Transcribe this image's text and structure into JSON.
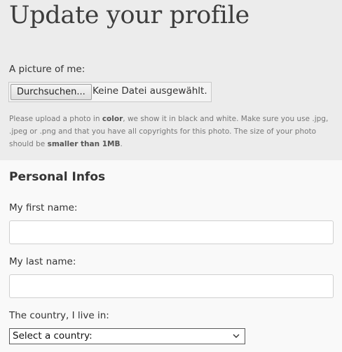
{
  "header": {
    "title": "Update your profile"
  },
  "picture": {
    "label": "A picture of me:",
    "button_label": "Durchsuchen...",
    "file_status": "Keine Datei ausgewählt.",
    "help": {
      "part1": "Please upload a photo in ",
      "bold1": "color",
      "part2": ", we show it in black and white. Make sure you use .jpg, .jpeg or .png and that you have all copyrights for this photo. The size of your photo should be ",
      "bold2": "smaller than 1MB",
      "part3": "."
    }
  },
  "personal": {
    "section_title": "Personal Infos",
    "first_name": {
      "label": "My first name:",
      "value": "",
      "placeholder": ""
    },
    "last_name": {
      "label": "My last name:",
      "value": "",
      "placeholder": ""
    },
    "country": {
      "label": "The country, I live in:",
      "selected": "Select a country:"
    }
  },
  "icons": {
    "select_arrow": "chevron-down-icon"
  }
}
